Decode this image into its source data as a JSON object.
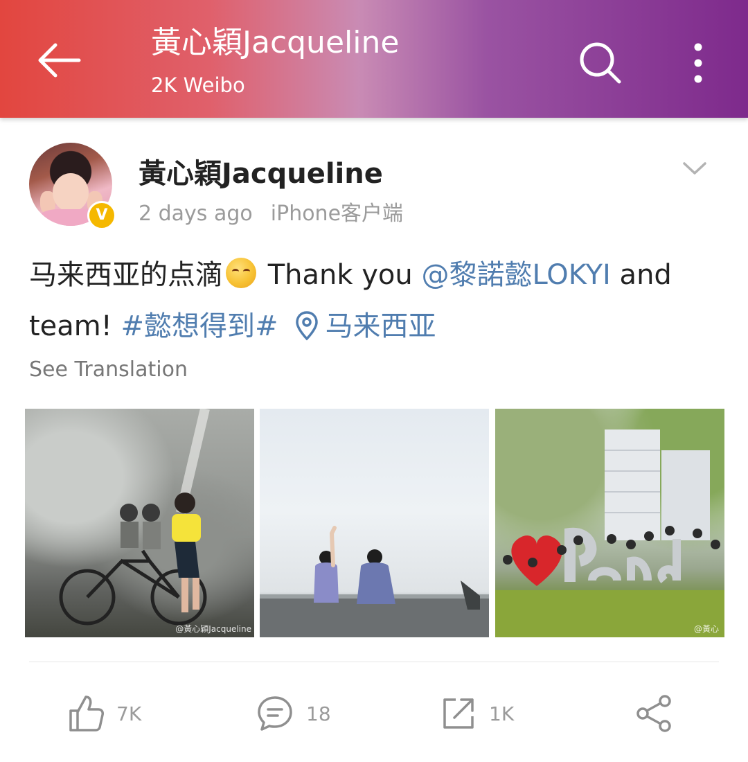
{
  "header": {
    "title": "黃心穎Jacqueline",
    "subtitle": "2K Weibo"
  },
  "post": {
    "author": "黃心穎Jacqueline",
    "verified_badge": "V",
    "time": "2 days ago",
    "source": "iPhone客户端",
    "text_part1": "马来西亚的点滴",
    "text_part2": " Thank you ",
    "mention": "@黎諾懿LOKYI",
    "text_part3": " and team! ",
    "hashtag": "#懿想得到#",
    "location": "马来西亚",
    "see_translation": "See Translation",
    "watermark1": "@黃心穎Jacqueline",
    "watermark3": "@黃心"
  },
  "actions": {
    "likes": "7K",
    "comments": "18",
    "reposts": "1K"
  },
  "colors": {
    "link": "#507daf",
    "verified": "#f5b800",
    "header_gradient_start": "#e2463f",
    "header_gradient_end": "#7e2a8c"
  }
}
